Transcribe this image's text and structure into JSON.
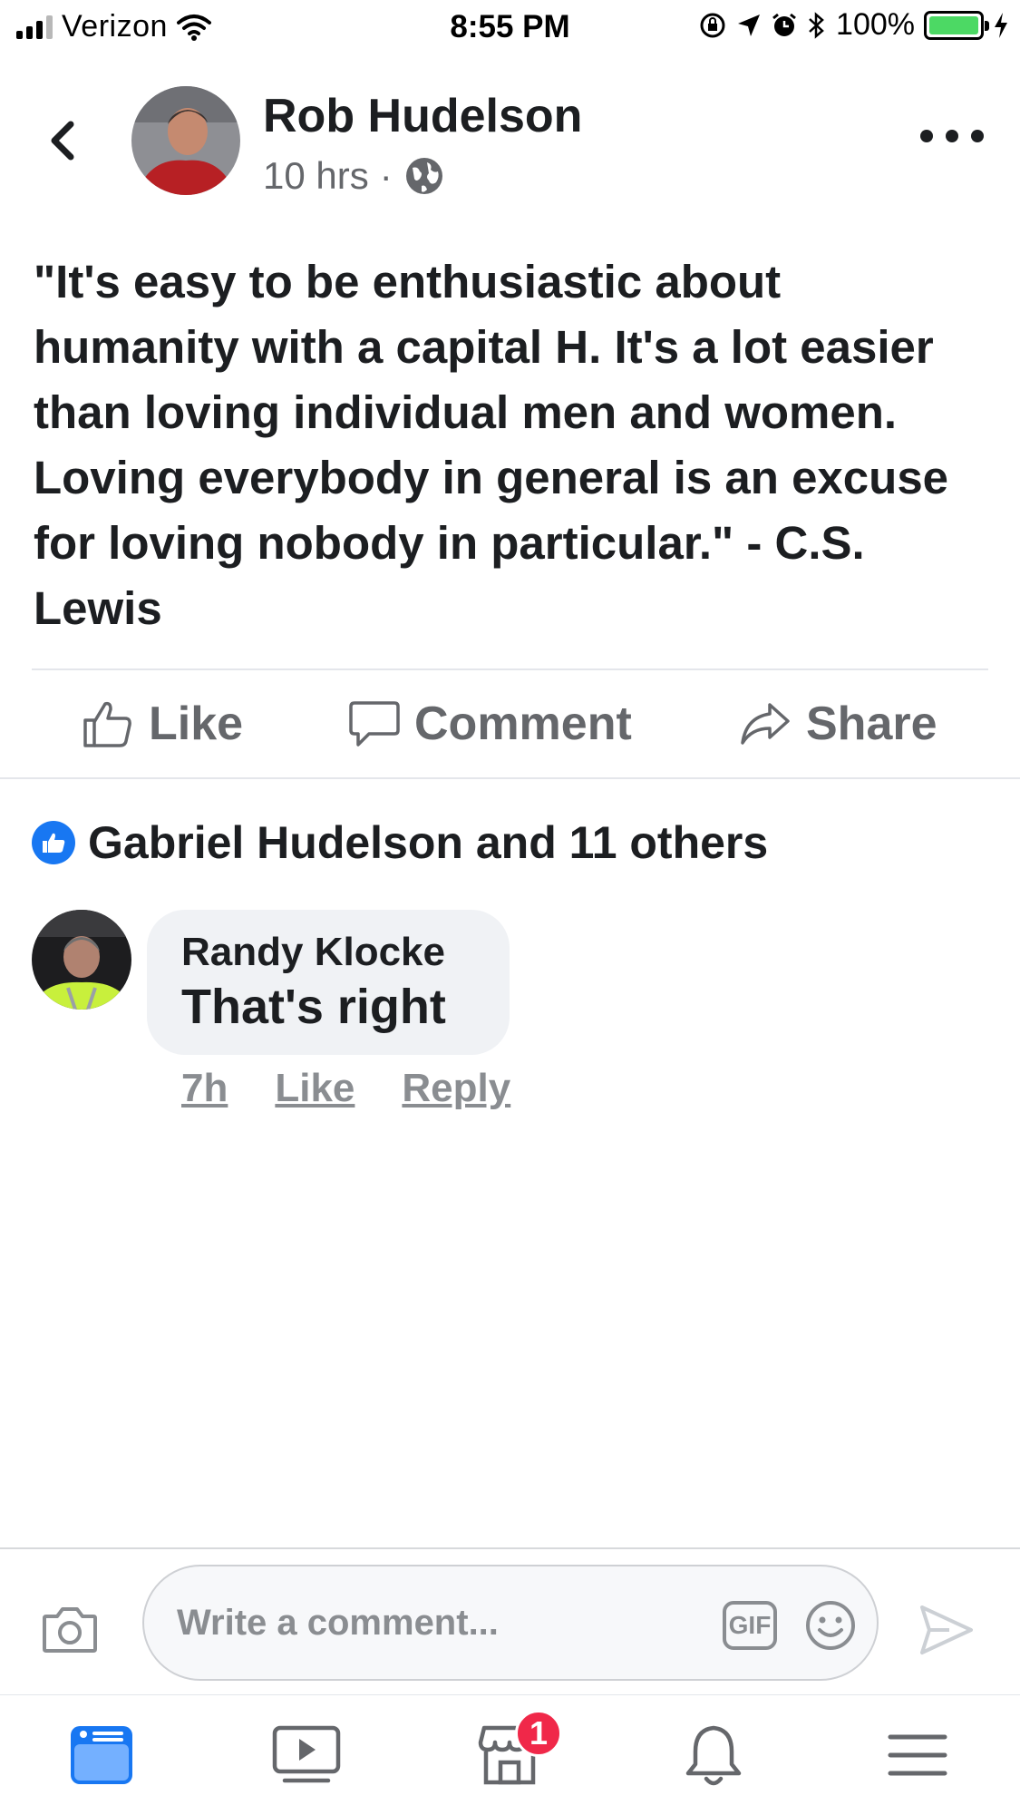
{
  "status_bar": {
    "carrier": "Verizon",
    "time": "8:55 PM",
    "battery_percent": "100%",
    "battery_level": 1.0,
    "icons": [
      "wifi-icon",
      "orientation-lock-icon",
      "location-arrow-icon",
      "alarm-icon",
      "bluetooth-icon",
      "charging-bolt-icon"
    ]
  },
  "post": {
    "author": "Rob Hudelson",
    "time_ago": "10 hrs",
    "separator": "·",
    "audience_icon": "globe-icon",
    "text": "\"It's easy to be enthusiastic about humanity with a capital H. It's a lot easier than loving individual men and women. Loving everybody in general is an excuse for loving nobody in particular.\" - C.S. Lewis"
  },
  "actions": {
    "like_label": "Like",
    "comment_label": "Comment",
    "share_label": "Share"
  },
  "reactions": {
    "summary": "Gabriel Hudelson and 11 others"
  },
  "comments": [
    {
      "name": "Randy Klocke",
      "text": "That's right",
      "time": "7h",
      "like_label": "Like",
      "reply_label": "Reply"
    }
  ],
  "composer": {
    "placeholder": "Write a comment...",
    "gif_label": "GIF"
  },
  "tab_bar": {
    "marketplace_badge": "1",
    "active_tab": "news-feed"
  },
  "colors": {
    "accent": "#1877f2",
    "badge": "#f02849",
    "battery": "#4cd964",
    "muted_text": "#65676b"
  }
}
